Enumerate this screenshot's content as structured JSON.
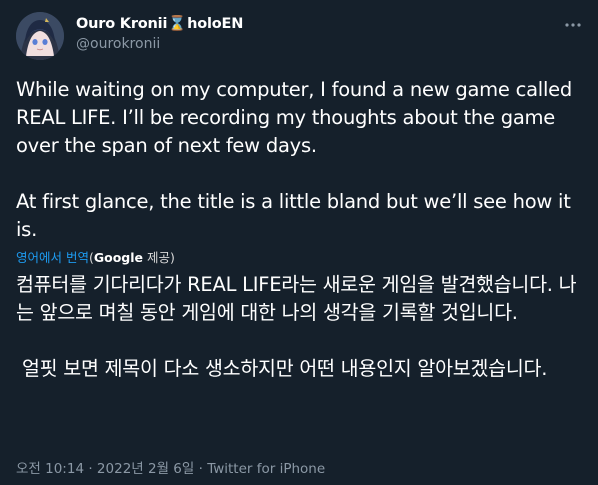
{
  "author": {
    "name": "Ouro Kronii",
    "badge": "⌛",
    "name_suffix": "holoEN",
    "handle": "@ourokronii"
  },
  "icons": {
    "avatar": "avatar-image",
    "more": "more-horizontal-icon"
  },
  "tweet": {
    "text_en": "While waiting on my computer, I found a new game called REAL LIFE. I’ll be recording my thoughts about the game over the span of next few days.\n\nAt first glance, the title is a little bland but we’ll see how it is.",
    "translate_link": "영어에서 번역",
    "translate_prefix": "(",
    "translate_google": "Google",
    "translate_suffix": " 제공)",
    "text_ko": "컴퓨터를 기다리다가 REAL LIFE라는 새로운 게임을 발견했습니다. 나는 앞으로 며칠 동안 게임에 대한 나의 생각을 기록할 것입니다.\n\n 얼핏 보면 제목이 다소 생소하지만 어떤 내용인지 알아보겠습니다."
  },
  "meta": {
    "time": "오전 10:14",
    "sep1": " · ",
    "date": "2022년 2월 6일",
    "sep2": " · ",
    "source": "Twitter for iPhone"
  },
  "colors": {
    "background": "#15202b",
    "text": "#ffffff",
    "secondary": "#8b98a5",
    "link": "#1d9bf0",
    "hourglass": "#f4b93a"
  }
}
